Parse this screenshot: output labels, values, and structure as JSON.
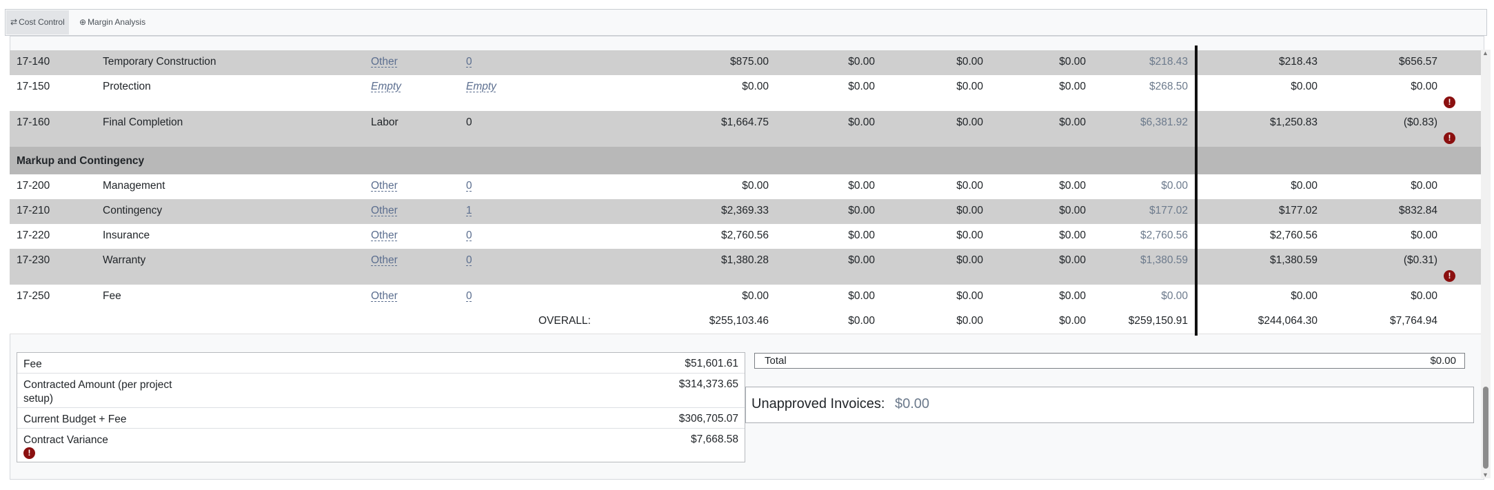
{
  "tabs": [
    {
      "label": "Cost Control",
      "icon": "arrows-swap-icon"
    },
    {
      "label": "Margin Analysis",
      "icon": "circle-plus-icon"
    }
  ],
  "rows": [
    {
      "code": "17-140",
      "desc": "Temporary Construction",
      "type": "Other",
      "qty": "0",
      "v1": "$875.00",
      "v2": "$0.00",
      "v3": "$0.00",
      "v4": "$0.00",
      "v5": "$218.43",
      "v6": "$218.43",
      "v7": "$656.57",
      "warn": false
    },
    {
      "code": "17-150",
      "desc": "Protection",
      "type": "Empty",
      "qty": "Empty",
      "v1": "$0.00",
      "v2": "$0.00",
      "v3": "$0.00",
      "v4": "$0.00",
      "v5": "$268.50",
      "v6": "$0.00",
      "v7": "$0.00",
      "warn": true
    },
    {
      "code": "17-160",
      "desc": "Final Completion",
      "type": "Labor",
      "qty": "0",
      "v1": "$1,664.75",
      "v2": "$0.00",
      "v3": "$0.00",
      "v4": "$0.00",
      "v5": "$6,381.92",
      "v6": "$1,250.83",
      "v7": "($0.83)",
      "warn": true
    },
    {
      "section": "Markup and Contingency"
    },
    {
      "code": "17-200",
      "desc": "Management",
      "type": "Other",
      "qty": "0",
      "v1": "$0.00",
      "v2": "$0.00",
      "v3": "$0.00",
      "v4": "$0.00",
      "v5": "$0.00",
      "v6": "$0.00",
      "v7": "$0.00",
      "warn": false
    },
    {
      "code": "17-210",
      "desc": "Contingency",
      "type": "Other",
      "qty": "1",
      "v1": "$2,369.33",
      "v2": "$0.00",
      "v3": "$0.00",
      "v4": "$0.00",
      "v5": "$177.02",
      "v6": "$177.02",
      "v7": "$832.84",
      "warn": false
    },
    {
      "code": "17-220",
      "desc": "Insurance",
      "type": "Other",
      "qty": "0",
      "v1": "$2,760.56",
      "v2": "$0.00",
      "v3": "$0.00",
      "v4": "$0.00",
      "v5": "$2,760.56",
      "v6": "$2,760.56",
      "v7": "$0.00",
      "warn": false
    },
    {
      "code": "17-230",
      "desc": "Warranty",
      "type": "Other",
      "qty": "0",
      "v1": "$1,380.28",
      "v2": "$0.00",
      "v3": "$0.00",
      "v4": "$0.00",
      "v5": "$1,380.59",
      "v6": "$1,380.59",
      "v7": "($0.31)",
      "warn": true
    },
    {
      "code": "17-250",
      "desc": "Fee",
      "type": "Other",
      "qty": "0",
      "v1": "$0.00",
      "v2": "$0.00",
      "v3": "$0.00",
      "v4": "$0.00",
      "v5": "$0.00",
      "v6": "$0.00",
      "v7": "$0.00",
      "warn": false
    }
  ],
  "overall": {
    "label": "OVERALL:",
    "v1": "$255,103.46",
    "v2": "$0.00",
    "v3": "$0.00",
    "v4": "$0.00",
    "v5": "$259,150.91",
    "v6": "$244,064.30",
    "v7": "$7,764.94"
  },
  "summary": [
    {
      "label": "Fee",
      "value": "$51,601.61"
    },
    {
      "label": "Contracted Amount (per project setup)",
      "value": "$314,373.65"
    },
    {
      "label": "Current Budget + Fee",
      "value": "$306,705.07"
    },
    {
      "label": "Contract Variance",
      "value": "$7,668.58",
      "warn": true
    }
  ],
  "total": {
    "label": "Total",
    "value": "$0.00"
  },
  "unapproved": {
    "label": "Unapproved Invoices:",
    "value": "$0.00"
  },
  "warn_glyph": "!",
  "colors": {
    "warning": "#8b1010",
    "link": "#5b6e8f",
    "alt_row": "#cfcfcf",
    "section_row": "#b8b8b8"
  }
}
